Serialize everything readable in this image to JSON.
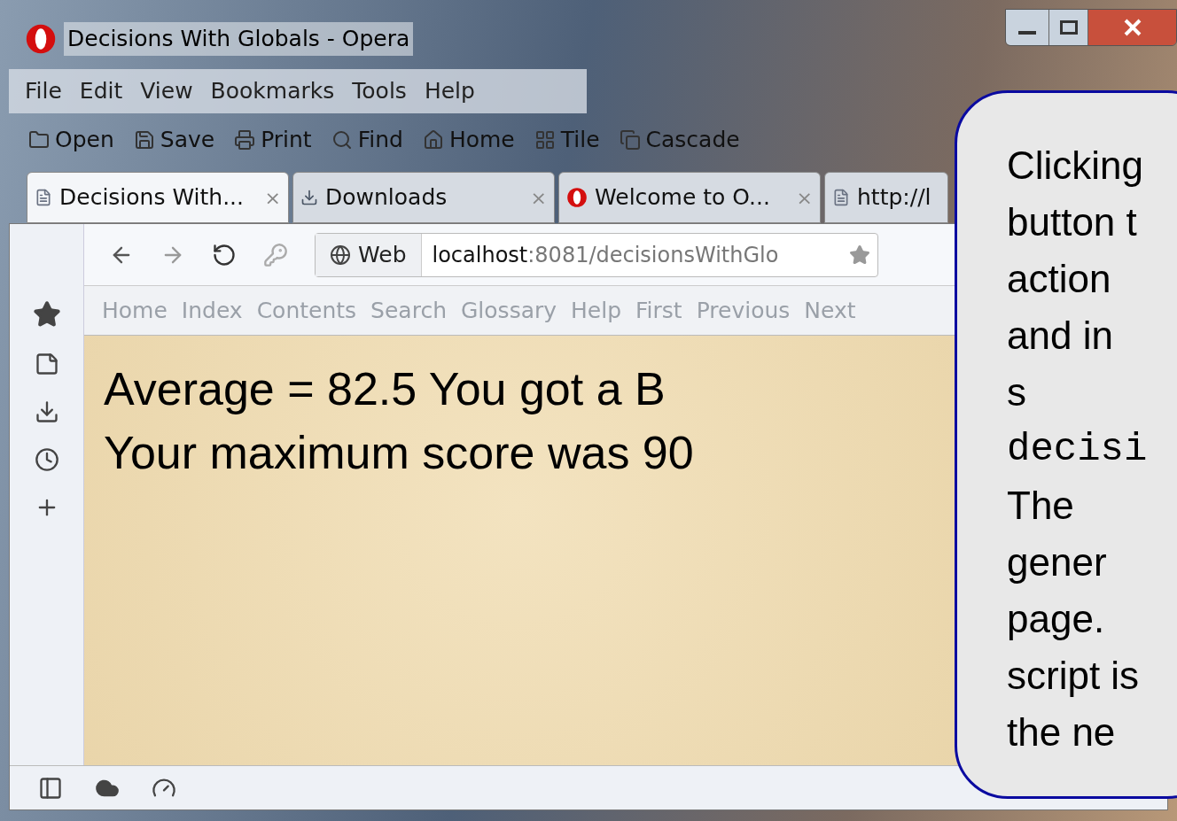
{
  "window": {
    "title": "Decisions With Globals - Opera"
  },
  "menu": [
    "File",
    "Edit",
    "View",
    "Bookmarks",
    "Tools",
    "Help"
  ],
  "toolbar": [
    {
      "kind": "folder",
      "label": "Open"
    },
    {
      "kind": "save",
      "label": "Save"
    },
    {
      "kind": "print",
      "label": "Print"
    },
    {
      "kind": "find",
      "label": "Find"
    },
    {
      "kind": "home",
      "label": "Home"
    },
    {
      "kind": "tile",
      "label": "Tile"
    },
    {
      "kind": "cascade",
      "label": "Cascade"
    }
  ],
  "tabs": [
    {
      "kind": "page",
      "label": "Decisions With...",
      "close": "×",
      "selected": true
    },
    {
      "kind": "downloads",
      "label": "Downloads",
      "close": "×",
      "selected": false
    },
    {
      "kind": "opera",
      "label": "Welcome to O...",
      "close": "×",
      "selected": false
    },
    {
      "kind": "page",
      "label": "http://l",
      "selected": false
    }
  ],
  "address": {
    "scheme_label": "Web",
    "url_host": "localhost",
    "url_rest": ":8081/decisionsWithGlo"
  },
  "nav_links": [
    "Home",
    "Index",
    "Contents",
    "Search",
    "Glossary",
    "Help",
    "First",
    "Previous",
    "Next"
  ],
  "page": {
    "lines": [
      "Average = 82.5 You got a B",
      "Your maximum score was 90"
    ]
  },
  "callout": {
    "lines": [
      {
        "kind": "text",
        "text": "Clicking"
      },
      {
        "kind": "text",
        "text": "button t"
      },
      {
        "kind": "text",
        "text": "action"
      },
      {
        "kind": "text",
        "text": "and in"
      },
      {
        "kind": "text",
        "text": "s"
      },
      {
        "kind": "code",
        "text": "decisi"
      },
      {
        "kind": "text",
        "text": "The"
      },
      {
        "kind": "text",
        "text": "gener"
      },
      {
        "kind": "text",
        "text": "page."
      },
      {
        "kind": "text",
        "text": "script is"
      },
      {
        "kind": "text",
        "text": "the ne"
      }
    ]
  }
}
